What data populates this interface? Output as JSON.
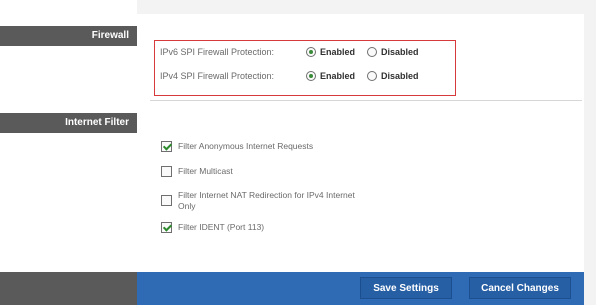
{
  "sections": {
    "firewall": {
      "label": "Firewall"
    },
    "internet_filter": {
      "label": "Internet Filter"
    }
  },
  "firewall": {
    "ipv6": {
      "label": "IPv6 SPI Firewall Protection:",
      "options": [
        "Enabled",
        "Disabled"
      ],
      "selected": "Enabled"
    },
    "ipv4": {
      "label": "IPv4 SPI Firewall Protection:",
      "options": [
        "Enabled",
        "Disabled"
      ],
      "selected": "Enabled"
    }
  },
  "internet_filter": {
    "items": [
      {
        "label": "Filter Anonymous Internet Requests",
        "checked": true
      },
      {
        "label": "Filter Multicast",
        "checked": false
      },
      {
        "label": "Filter Internet NAT Redirection for IPv4 Internet",
        "label2": "Only",
        "checked": false
      },
      {
        "label": "Filter IDENT (Port 113)",
        "checked": true
      }
    ]
  },
  "footer": {
    "save_label": "Save Settings",
    "cancel_label": "Cancel Changes"
  },
  "colors": {
    "section_bg": "#5a5a5a",
    "footer_bg": "#2f6bb5",
    "highlight": "#d63a3a",
    "check_green": "#2c8a2c"
  }
}
